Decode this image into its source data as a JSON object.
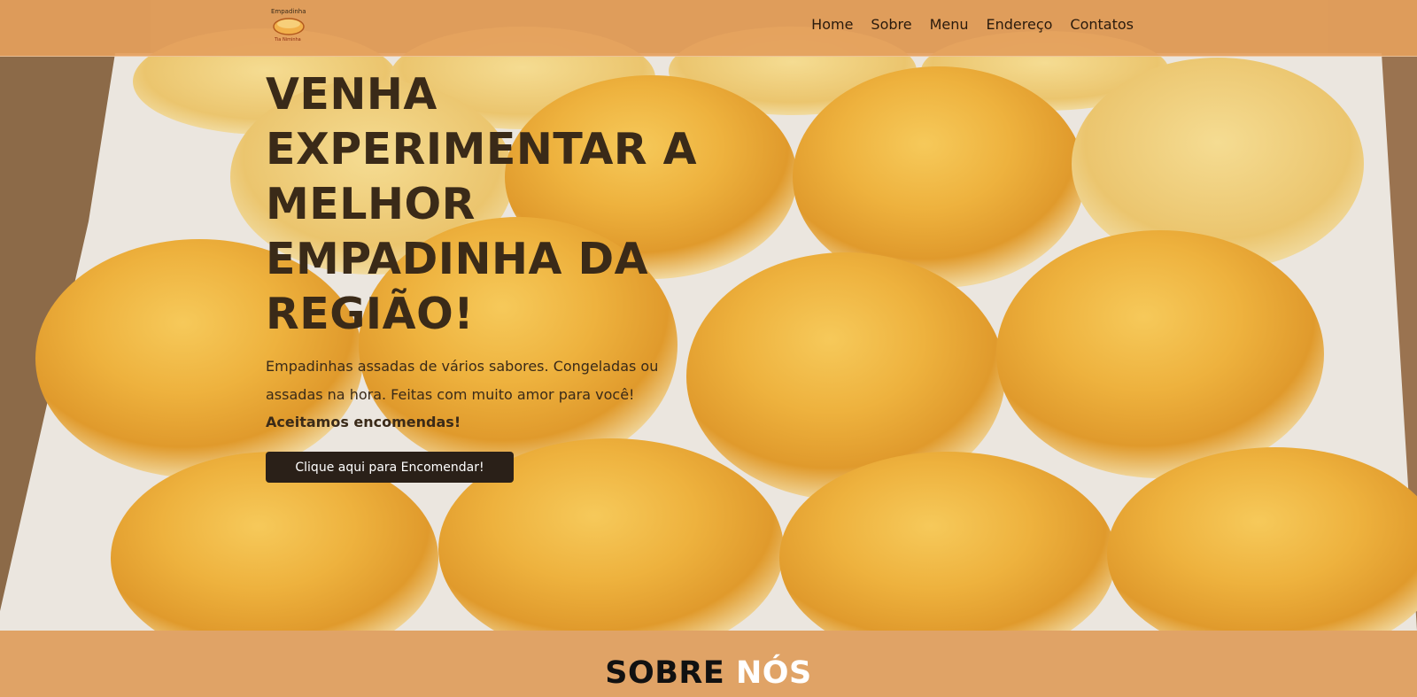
{
  "brand": {
    "logo_text_top": "Empadinha",
    "logo_text_bottom": "Tia Niminha"
  },
  "nav": {
    "items": [
      "Home",
      "Sobre",
      "Menu",
      "Endereço",
      "Contatos"
    ]
  },
  "hero": {
    "title": "VENHA EXPERIMENTAR A MELHOR EMPADINHA DA REGIÃO!",
    "description": "Empadinhas assadas de vários sabores. Congeladas ou assadas na hora. Feitas com muito amor para você!",
    "highlight": "Aceitamos encomendas!",
    "button_label": "Clique aqui para Encomendar!"
  },
  "about": {
    "title_word1": "SOBRE",
    "title_word2": "NÓS"
  },
  "colors": {
    "navbar": "#e4a05c",
    "about_bg": "#e0a366",
    "button_bg": "#2a2018",
    "text_dark": "#3a2a18"
  }
}
